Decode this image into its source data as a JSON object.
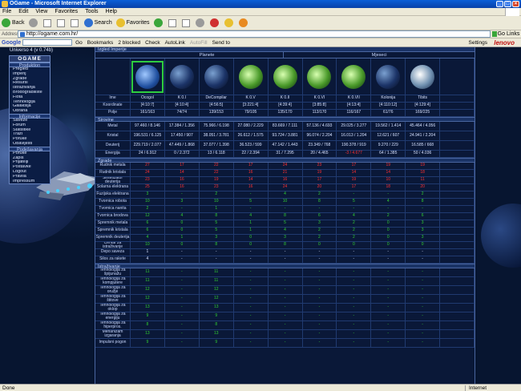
{
  "window": {
    "title": "OGame - Microsoft Internet Explorer"
  },
  "menu": [
    "File",
    "Edit",
    "View",
    "Favorites",
    "Tools",
    "Help"
  ],
  "toolbar": {
    "back": "Back",
    "search": "Search",
    "favorites": "Favorites"
  },
  "address": {
    "label": "Address",
    "url": "http://ogame.com.hr/",
    "go": "Go",
    "links": "Links"
  },
  "googlebar": {
    "logo": "Google",
    "go": "Go",
    "bookmarks": "Bookmarks",
    "blocked": "2 blocked",
    "check": "Check",
    "autolink": "AutoLink",
    "autofill": "AutoFill",
    "sendto": "Send to",
    "settings": "Settings",
    "brand": "lenovo"
  },
  "universe": "Universo 4 (v 0.74b)",
  "left_menu": {
    "logo": "OGAME",
    "sec1": "Produktion",
    "items1": [
      "Pregled",
      "Imperij",
      "Zgrade",
      "Resursi",
      "Istraživanja",
      "Brodogradilište",
      "Flota",
      "Tehnologija",
      "Galaksija",
      "Obrana"
    ],
    "sec2": "Informacije",
    "items2": [
      "Saveze",
      "Forum",
      "Statistike",
      "Traži",
      "Poruke",
      "Obavijesti"
    ],
    "sec3": "Podešavanja",
    "items3": [
      "Poruke",
      "Zapis",
      "Prijatelji",
      "Postavke",
      "Logout",
      "Pravila",
      "Impressum"
    ]
  },
  "main": {
    "header": "Izgled Imperije",
    "group_planets": "Planete",
    "group_moons": "Mjeseci",
    "row_name": "Ime",
    "row_coord": "Koordinate",
    "row_fields": "Polje",
    "names": [
      "Ocogol",
      "K 0.I",
      "DeCompilar",
      "K 0.V",
      "K 0.II",
      "K 0.VI",
      "K 0.VII",
      "Kolonija",
      "Tibits"
    ],
    "coords": [
      "[4:10:7]",
      "[4:10:4]",
      "[4:56:5]",
      "[3:221:4]",
      "[4:39:4]",
      "[3:85:8]",
      "[4:13:4]",
      "[4:110:12]",
      "[4:129:4]"
    ],
    "fields": [
      "161/163",
      "74/74",
      "139/153",
      "79/105",
      "135/170",
      "113/170",
      "116/167",
      "61/76",
      "169/225"
    ],
    "resources_header": "Sirovine",
    "res_labels": [
      "Metal",
      "Kristal",
      "Deuterij",
      "Energija"
    ],
    "metal": [
      "97.460 / 8.146",
      "17.384 / 1.356",
      "75.966 / 6.198",
      "27.080 / 2.229",
      "83.669 / 7.111",
      "57.136 / 4.693",
      "29.025 / 3.277",
      "19.562 / 1.414",
      "45.464 / 4.056"
    ],
    "crystal": [
      "196.531 / 6.125",
      "17.450 / 907",
      "38.051 / 3.781",
      "26.612 / 1.575",
      "93.724 / 3.881",
      "96.074 / 2.204",
      "16.013 / 1.204",
      "12.621 / 607",
      "24.941 / 2.204"
    ],
    "deuterium": [
      "229.719 / 2.077",
      "47.449 / 1.868",
      "37.077 / 1.398",
      "36.523 / 599",
      "47.142 / 1.443",
      "23.349 / 768",
      "190.378 / 919",
      "9.270 / 229",
      "16.585 / 668"
    ],
    "energy": [
      "24 / 6.912",
      "0 / 2.372",
      "13 / 6.118",
      "22 / 2.394",
      "31 / 7.295",
      "20 / 4.465",
      "-3 / 4.677",
      "64 / 1.385",
      "50 / 4.036"
    ],
    "buildings_header": "Zgrade",
    "buildings": [
      {
        "label": "Rudnik metala",
        "vals": [
          "27",
          "17",
          "22",
          "17",
          "24",
          "23",
          "17",
          "19",
          "19"
        ]
      },
      {
        "label": "Rudnik kristala",
        "vals": [
          "24",
          "14",
          "22",
          "16",
          "21",
          "19",
          "14",
          "14",
          "18"
        ]
      },
      {
        "label": "Sintetizator deuterija",
        "vals": [
          "23",
          "16",
          "19",
          "14",
          "16",
          "17",
          "19",
          "10",
          "11"
        ]
      },
      {
        "label": "Solarna elektrana",
        "vals": [
          "25",
          "16",
          "23",
          "16",
          "24",
          "20",
          "17",
          "18",
          "20"
        ]
      },
      {
        "label": "Fuzijska elektrana",
        "vals": [
          "3",
          "-",
          "2",
          "-",
          "4",
          "2",
          "-",
          "-",
          "2"
        ]
      },
      {
        "label": "Tvornica robota",
        "vals": [
          "10",
          "3",
          "10",
          "5",
          "10",
          "8",
          "5",
          "4",
          "8"
        ]
      },
      {
        "label": "Tvornica nanita",
        "vals": [
          "2",
          "-",
          "1",
          "-",
          "-",
          "-",
          "-",
          "-",
          "-"
        ]
      },
      {
        "label": "Tvornica brodova",
        "vals": [
          "12",
          "4",
          "8",
          "4",
          "8",
          "6",
          "4",
          "2",
          "6"
        ]
      },
      {
        "label": "Spremnik metala",
        "vals": [
          "6",
          "0",
          "5",
          "1",
          "5",
          "3",
          "2",
          "0",
          "3"
        ]
      },
      {
        "label": "Spremnik kristala",
        "vals": [
          "6",
          "0",
          "5",
          "1",
          "4",
          "2",
          "2",
          "0",
          "3"
        ]
      },
      {
        "label": "Spremnik deuterija",
        "vals": [
          "4",
          "1",
          "3",
          "0",
          "3",
          "2",
          "2",
          "0",
          "3"
        ]
      },
      {
        "label": "Centar za istraživanje",
        "vals": [
          "10",
          "0",
          "8",
          "0",
          "8",
          "0",
          "0",
          "0",
          "0"
        ]
      },
      {
        "label": "Depo saveza",
        "vals": [
          "1",
          "-",
          "-",
          "-",
          "-",
          "-",
          "-",
          "-",
          "-"
        ]
      },
      {
        "label": "Silos za rakete",
        "vals": [
          "4",
          "-",
          "-",
          "-",
          "-",
          "-",
          "-",
          "-",
          "-"
        ]
      }
    ],
    "research_header": "Istraživanje",
    "research": [
      {
        "label": "Tehnologija za špijunažu",
        "vals": [
          "11",
          "-",
          "11",
          "-",
          "-",
          "-",
          "-",
          "-",
          "-"
        ]
      },
      {
        "label": "Tehnologija za kompjutere",
        "vals": [
          "11",
          "-",
          "11",
          "-",
          "-",
          "-",
          "-",
          "-",
          "-"
        ]
      },
      {
        "label": "Tehnologija za oružje",
        "vals": [
          "12",
          "-",
          "12",
          "-",
          "-",
          "-",
          "-",
          "-",
          "-"
        ]
      },
      {
        "label": "Tehnologija za štitove",
        "vals": [
          "12",
          "-",
          "12",
          "-",
          "-",
          "-",
          "-",
          "-",
          "-"
        ]
      },
      {
        "label": "Tehnologija za oklop",
        "vals": [
          "13",
          "-",
          "13",
          "-",
          "-",
          "-",
          "-",
          "-",
          "-"
        ]
      },
      {
        "label": "Tehnologija za energiju",
        "vals": [
          "9",
          "-",
          "9",
          "-",
          "-",
          "-",
          "-",
          "-",
          "-"
        ]
      },
      {
        "label": "Tehnologija za hiperpros.",
        "vals": [
          "8",
          "-",
          "8",
          "-",
          "-",
          "-",
          "-",
          "-",
          "-"
        ]
      },
      {
        "label": "Mehanizam izgaranja",
        "vals": [
          "13",
          "-",
          "13",
          "-",
          "-",
          "-",
          "-",
          "-",
          "-"
        ]
      },
      {
        "label": "Impulsni pogon",
        "vals": [
          "9",
          "-",
          "9",
          "-",
          "-",
          "-",
          "-",
          "-",
          "-"
        ]
      }
    ]
  },
  "status": {
    "left": "Done",
    "zone": "Internet"
  }
}
